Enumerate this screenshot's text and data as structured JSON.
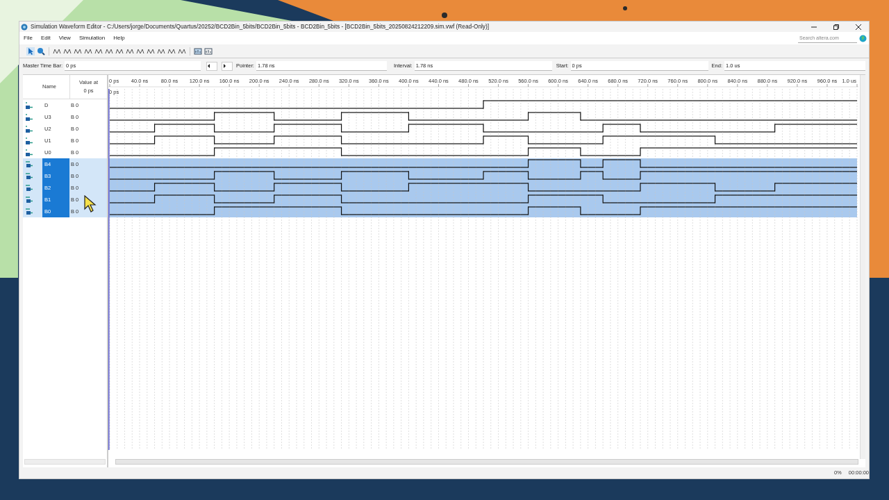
{
  "window": {
    "title": "Simulation Waveform Editor - C:/Users/jorge/Documents/Quartus/20252/BCD2Bin_5bits/BCD2Bin_5bits - BCD2Bin_5bits - [BCD2Bin_5bits_20250824212209.sim.vwf (Read-Only)]"
  },
  "menu": [
    "File",
    "Edit",
    "View",
    "Simulation",
    "Help"
  ],
  "search": {
    "placeholder": "Search altera.com"
  },
  "time_bar": {
    "master_label": "Master Time Bar:",
    "master": "0 ps",
    "pointer_label": "Pointer:",
    "pointer": "1.78 ns",
    "interval_label": "Interval:",
    "interval": "1.78 ns",
    "start_label": "Start:",
    "start": "0 ps",
    "end_label": "End:",
    "end": "1.0 us"
  },
  "columns": {
    "name": "Name",
    "value": "Value at\n0 ps"
  },
  "ruler": [
    "0 ps",
    "40.0 ns",
    "80.0 ns",
    "120.0 ns",
    "160.0 ns",
    "200.0 ns",
    "240.0 ns",
    "280.0 ns",
    "320.0 ns",
    "360.0 ns",
    "400.0 ns",
    "440.0 ns",
    "480.0 ns",
    "520.0 ns",
    "560.0 ns",
    "600.0 ns",
    "640.0 ns",
    "680.0 ns",
    "720.0 ns",
    "760.0 ns",
    "800.0 ns",
    "840.0 ns",
    "880.0 ns",
    "920.0 ns",
    "960.0 ns",
    "1.0 us"
  ],
  "cursor_label": "0 ps",
  "signals": [
    {
      "kind": "in",
      "name": "D",
      "value": "B 0",
      "selected": false,
      "high": [
        false,
        false,
        false,
        false,
        false,
        false,
        false,
        false,
        false,
        false,
        false,
        false,
        false,
        false,
        false,
        false,
        false,
        false,
        false,
        false,
        false,
        false,
        false,
        false,
        false,
        false,
        false,
        false,
        false,
        false,
        false,
        false,
        false,
        false,
        false,
        false,
        false,
        false,
        false,
        false,
        false,
        false,
        false,
        false,
        false,
        false,
        false,
        false,
        false,
        false,
        true,
        true,
        true,
        true,
        true,
        true,
        true,
        true,
        true,
        true,
        true,
        true,
        true,
        true,
        true,
        true,
        true,
        true,
        true,
        true,
        true,
        true,
        true,
        true,
        true,
        true,
        true,
        true,
        true,
        true,
        true,
        true,
        true,
        true,
        true,
        true,
        true,
        true,
        true,
        true,
        true,
        true,
        true,
        true,
        true,
        true,
        true,
        true,
        true,
        true
      ]
    },
    {
      "kind": "in",
      "name": "U3",
      "value": "B 0",
      "selected": false,
      "high": [
        false,
        false,
        false,
        false,
        false,
        false,
        false,
        false,
        false,
        false,
        false,
        false,
        false,
        false,
        true,
        true,
        true,
        true,
        true,
        true,
        true,
        true,
        false,
        false,
        false,
        false,
        false,
        false,
        false,
        false,
        false,
        true,
        true,
        true,
        true,
        true,
        true,
        true,
        true,
        true,
        false,
        false,
        false,
        false,
        false,
        false,
        false,
        false,
        false,
        false,
        false,
        false,
        false,
        false,
        false,
        false,
        true,
        true,
        true,
        true,
        true,
        true,
        true,
        false,
        false,
        false,
        false,
        false,
        false,
        false,
        false,
        false,
        false,
        false,
        false,
        false,
        false,
        false,
        false,
        false,
        false,
        false,
        false,
        false,
        false,
        false,
        false,
        false,
        false,
        false,
        false,
        false,
        false,
        false,
        false,
        false,
        false,
        false,
        false,
        false
      ]
    },
    {
      "kind": "in",
      "name": "U2",
      "value": "B 0",
      "selected": false,
      "high": [
        false,
        false,
        false,
        false,
        false,
        false,
        true,
        true,
        true,
        true,
        true,
        true,
        true,
        true,
        false,
        false,
        false,
        false,
        false,
        false,
        false,
        false,
        true,
        true,
        true,
        true,
        true,
        true,
        true,
        true,
        true,
        false,
        false,
        false,
        false,
        false,
        false,
        false,
        false,
        false,
        true,
        true,
        true,
        true,
        true,
        true,
        true,
        true,
        true,
        true,
        false,
        false,
        false,
        false,
        false,
        false,
        false,
        false,
        false,
        false,
        false,
        false,
        false,
        false,
        false,
        false,
        true,
        true,
        true,
        true,
        true,
        false,
        false,
        false,
        false,
        false,
        false,
        false,
        false,
        false,
        false,
        false,
        false,
        false,
        false,
        false,
        false,
        false,
        false,
        true,
        true,
        true,
        true,
        true,
        true,
        true,
        true,
        true,
        true,
        true
      ]
    },
    {
      "kind": "in",
      "name": "U1",
      "value": "B 0",
      "selected": false,
      "high": [
        false,
        false,
        false,
        false,
        false,
        false,
        true,
        true,
        true,
        true,
        true,
        true,
        true,
        true,
        false,
        false,
        false,
        false,
        false,
        false,
        false,
        false,
        true,
        true,
        true,
        true,
        true,
        true,
        true,
        true,
        true,
        false,
        false,
        false,
        false,
        false,
        false,
        false,
        false,
        false,
        false,
        false,
        false,
        false,
        false,
        false,
        false,
        false,
        false,
        false,
        true,
        true,
        true,
        true,
        true,
        true,
        false,
        false,
        false,
        false,
        false,
        false,
        false,
        false,
        false,
        false,
        true,
        true,
        true,
        true,
        true,
        true,
        true,
        true,
        true,
        true,
        true,
        true,
        true,
        true,
        true,
        false,
        false,
        false,
        false,
        false,
        false,
        false,
        false,
        false,
        false,
        false,
        false,
        false,
        false,
        false,
        false,
        false,
        false,
        false
      ]
    },
    {
      "kind": "in",
      "name": "U0",
      "value": "B 0",
      "selected": false,
      "high": [
        false,
        false,
        false,
        false,
        false,
        false,
        false,
        false,
        false,
        false,
        false,
        false,
        false,
        false,
        true,
        true,
        true,
        true,
        true,
        true,
        true,
        true,
        true,
        true,
        true,
        true,
        true,
        true,
        true,
        true,
        true,
        false,
        false,
        false,
        false,
        false,
        false,
        false,
        false,
        false,
        false,
        false,
        false,
        false,
        false,
        false,
        false,
        false,
        false,
        false,
        false,
        false,
        false,
        false,
        false,
        false,
        true,
        true,
        true,
        true,
        true,
        true,
        true,
        false,
        false,
        false,
        false,
        false,
        false,
        false,
        false,
        true,
        true,
        true,
        true,
        true,
        true,
        true,
        true,
        true,
        true,
        true,
        true,
        true,
        true,
        true,
        true,
        true,
        true,
        true,
        true,
        true,
        true,
        true,
        true,
        true,
        true,
        true,
        true,
        true
      ]
    },
    {
      "kind": "out",
      "name": "B4",
      "value": "B 0",
      "selected": true,
      "high": [
        false,
        false,
        false,
        false,
        false,
        false,
        false,
        false,
        false,
        false,
        false,
        false,
        false,
        false,
        false,
        false,
        false,
        false,
        false,
        false,
        false,
        false,
        false,
        false,
        false,
        false,
        false,
        false,
        false,
        false,
        false,
        false,
        false,
        false,
        false,
        false,
        false,
        false,
        false,
        false,
        false,
        false,
        false,
        false,
        false,
        false,
        false,
        false,
        false,
        false,
        false,
        false,
        false,
        false,
        false,
        false,
        true,
        true,
        true,
        true,
        true,
        true,
        true,
        false,
        false,
        false,
        true,
        true,
        true,
        true,
        true,
        false,
        false,
        false,
        false,
        false,
        false,
        false,
        false,
        false,
        false,
        false,
        false,
        false,
        false,
        false,
        false,
        false,
        false,
        false,
        false,
        false,
        false,
        false,
        false,
        false,
        false,
        false,
        false,
        false
      ]
    },
    {
      "kind": "out",
      "name": "B3",
      "value": "B 0",
      "selected": true,
      "high": [
        false,
        false,
        false,
        false,
        false,
        false,
        false,
        false,
        false,
        false,
        false,
        false,
        false,
        false,
        true,
        true,
        true,
        true,
        true,
        true,
        true,
        true,
        false,
        false,
        false,
        false,
        false,
        false,
        false,
        false,
        false,
        true,
        true,
        true,
        true,
        true,
        true,
        true,
        true,
        true,
        false,
        false,
        false,
        false,
        false,
        false,
        false,
        false,
        false,
        false,
        true,
        true,
        true,
        true,
        true,
        true,
        false,
        false,
        false,
        false,
        false,
        false,
        false,
        true,
        true,
        true,
        false,
        false,
        false,
        false,
        false,
        true,
        true,
        true,
        true,
        true,
        true,
        true,
        true,
        true,
        true,
        true,
        true,
        true,
        true,
        true,
        true,
        true,
        true,
        true,
        true,
        true,
        true,
        true,
        true,
        true,
        true,
        true,
        true,
        true
      ]
    },
    {
      "kind": "out",
      "name": "B2",
      "value": "B 0",
      "selected": true,
      "high": [
        false,
        false,
        false,
        false,
        false,
        false,
        true,
        true,
        true,
        true,
        true,
        true,
        true,
        true,
        false,
        false,
        false,
        false,
        false,
        false,
        false,
        false,
        true,
        true,
        true,
        true,
        true,
        true,
        true,
        true,
        true,
        false,
        false,
        false,
        false,
        false,
        false,
        false,
        false,
        false,
        true,
        true,
        true,
        true,
        true,
        true,
        true,
        true,
        true,
        true,
        true,
        true,
        true,
        true,
        true,
        true,
        false,
        false,
        false,
        false,
        false,
        false,
        false,
        false,
        false,
        false,
        false,
        false,
        false,
        false,
        false,
        true,
        true,
        true,
        true,
        true,
        true,
        true,
        true,
        true,
        true,
        false,
        false,
        false,
        false,
        false,
        false,
        false,
        false,
        true,
        true,
        true,
        true,
        true,
        true,
        true,
        true,
        true,
        true,
        true
      ]
    },
    {
      "kind": "out",
      "name": "B1",
      "value": "B 0",
      "selected": true,
      "high": [
        false,
        false,
        false,
        false,
        false,
        false,
        true,
        true,
        true,
        true,
        true,
        true,
        true,
        true,
        false,
        false,
        false,
        false,
        false,
        false,
        false,
        false,
        true,
        true,
        true,
        true,
        true,
        true,
        true,
        true,
        true,
        false,
        false,
        false,
        false,
        false,
        false,
        false,
        false,
        false,
        false,
        false,
        false,
        false,
        false,
        false,
        false,
        false,
        false,
        false,
        false,
        false,
        false,
        false,
        false,
        false,
        true,
        true,
        true,
        true,
        true,
        true,
        true,
        true,
        true,
        true,
        false,
        false,
        false,
        false,
        false,
        false,
        false,
        false,
        false,
        false,
        false,
        false,
        false,
        false,
        false,
        true,
        true,
        true,
        true,
        true,
        true,
        true,
        true,
        true,
        true,
        true,
        true,
        true,
        true,
        true,
        true,
        true,
        true,
        true
      ]
    },
    {
      "kind": "out",
      "name": "B0",
      "value": "B 0",
      "selected": true,
      "high": [
        false,
        false,
        false,
        false,
        false,
        false,
        false,
        false,
        false,
        false,
        false,
        false,
        false,
        false,
        true,
        true,
        true,
        true,
        true,
        true,
        true,
        true,
        true,
        true,
        true,
        true,
        true,
        true,
        true,
        true,
        true,
        false,
        false,
        false,
        false,
        false,
        false,
        false,
        false,
        false,
        false,
        false,
        false,
        false,
        false,
        false,
        false,
        false,
        false,
        false,
        false,
        false,
        false,
        false,
        false,
        false,
        true,
        true,
        true,
        true,
        true,
        true,
        true,
        false,
        false,
        false,
        false,
        false,
        false,
        false,
        false,
        true,
        true,
        true,
        true,
        true,
        true,
        true,
        true,
        true,
        true,
        true,
        true,
        true,
        true,
        true,
        true,
        true,
        true,
        true,
        true,
        true,
        true,
        true,
        true,
        true,
        true,
        true,
        true,
        true
      ]
    }
  ],
  "status_bar": {
    "progress": "0%",
    "elapsed": "00:00:00"
  }
}
